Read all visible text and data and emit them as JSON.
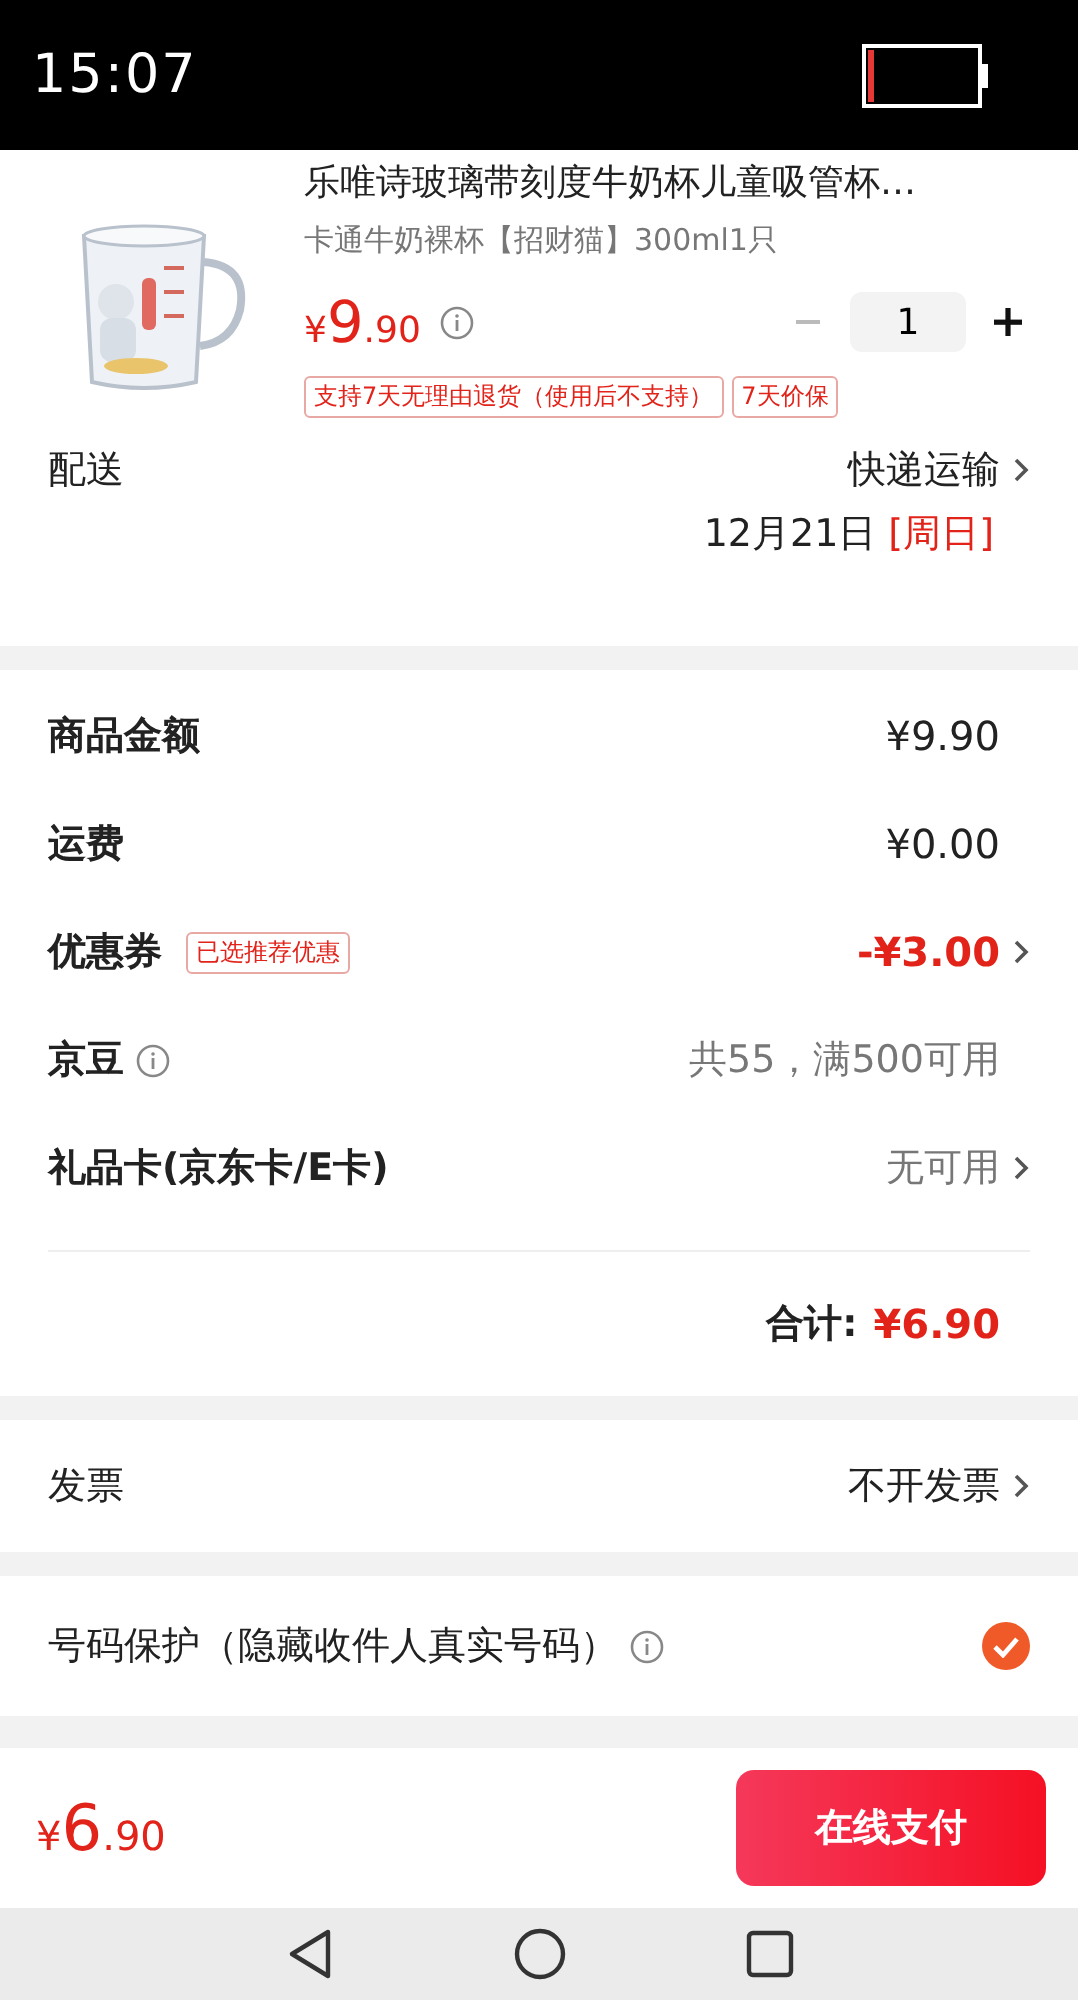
{
  "status_bar": {
    "time": "15:07"
  },
  "product": {
    "title": "乐唯诗玻璃带刻度牛奶杯儿童吸管杯…",
    "spec": "卡通牛奶裸杯【招财猫】300ml1只",
    "price": {
      "symbol": "¥",
      "integer": "9",
      "decimals": ".90"
    },
    "quantity": "1",
    "minus_disabled": true,
    "tags": [
      "支持7天无理由退货（使用后不支持）",
      "7天价保"
    ]
  },
  "delivery": {
    "label": "配送",
    "method": "快递运输",
    "date": "12月21日",
    "weekday": "[周日]"
  },
  "summary": [
    {
      "label": "商品金额",
      "value": "¥9.90",
      "kind": "plain"
    },
    {
      "label": "运费",
      "value": "¥0.00",
      "kind": "plain"
    },
    {
      "label": "优惠券",
      "badge": "已选推荐优惠",
      "value": "-¥3.00",
      "kind": "discount"
    },
    {
      "label": "京豆",
      "value": "共55，满500可用",
      "kind": "info"
    },
    {
      "label": "礼品卡(京东卡/E卡)",
      "value": "无可用",
      "kind": "muted"
    }
  ],
  "total": {
    "label": "合计:",
    "value": "¥6.90"
  },
  "invoice": {
    "label": "发票",
    "value": "不开发票"
  },
  "number_protection": {
    "label": "号码保护（隐藏收件人真实号码）",
    "checked": true
  },
  "footer": {
    "price": {
      "symbol": "¥",
      "integer": "6",
      "decimals": ".90"
    },
    "pay_button": "在线支付"
  }
}
